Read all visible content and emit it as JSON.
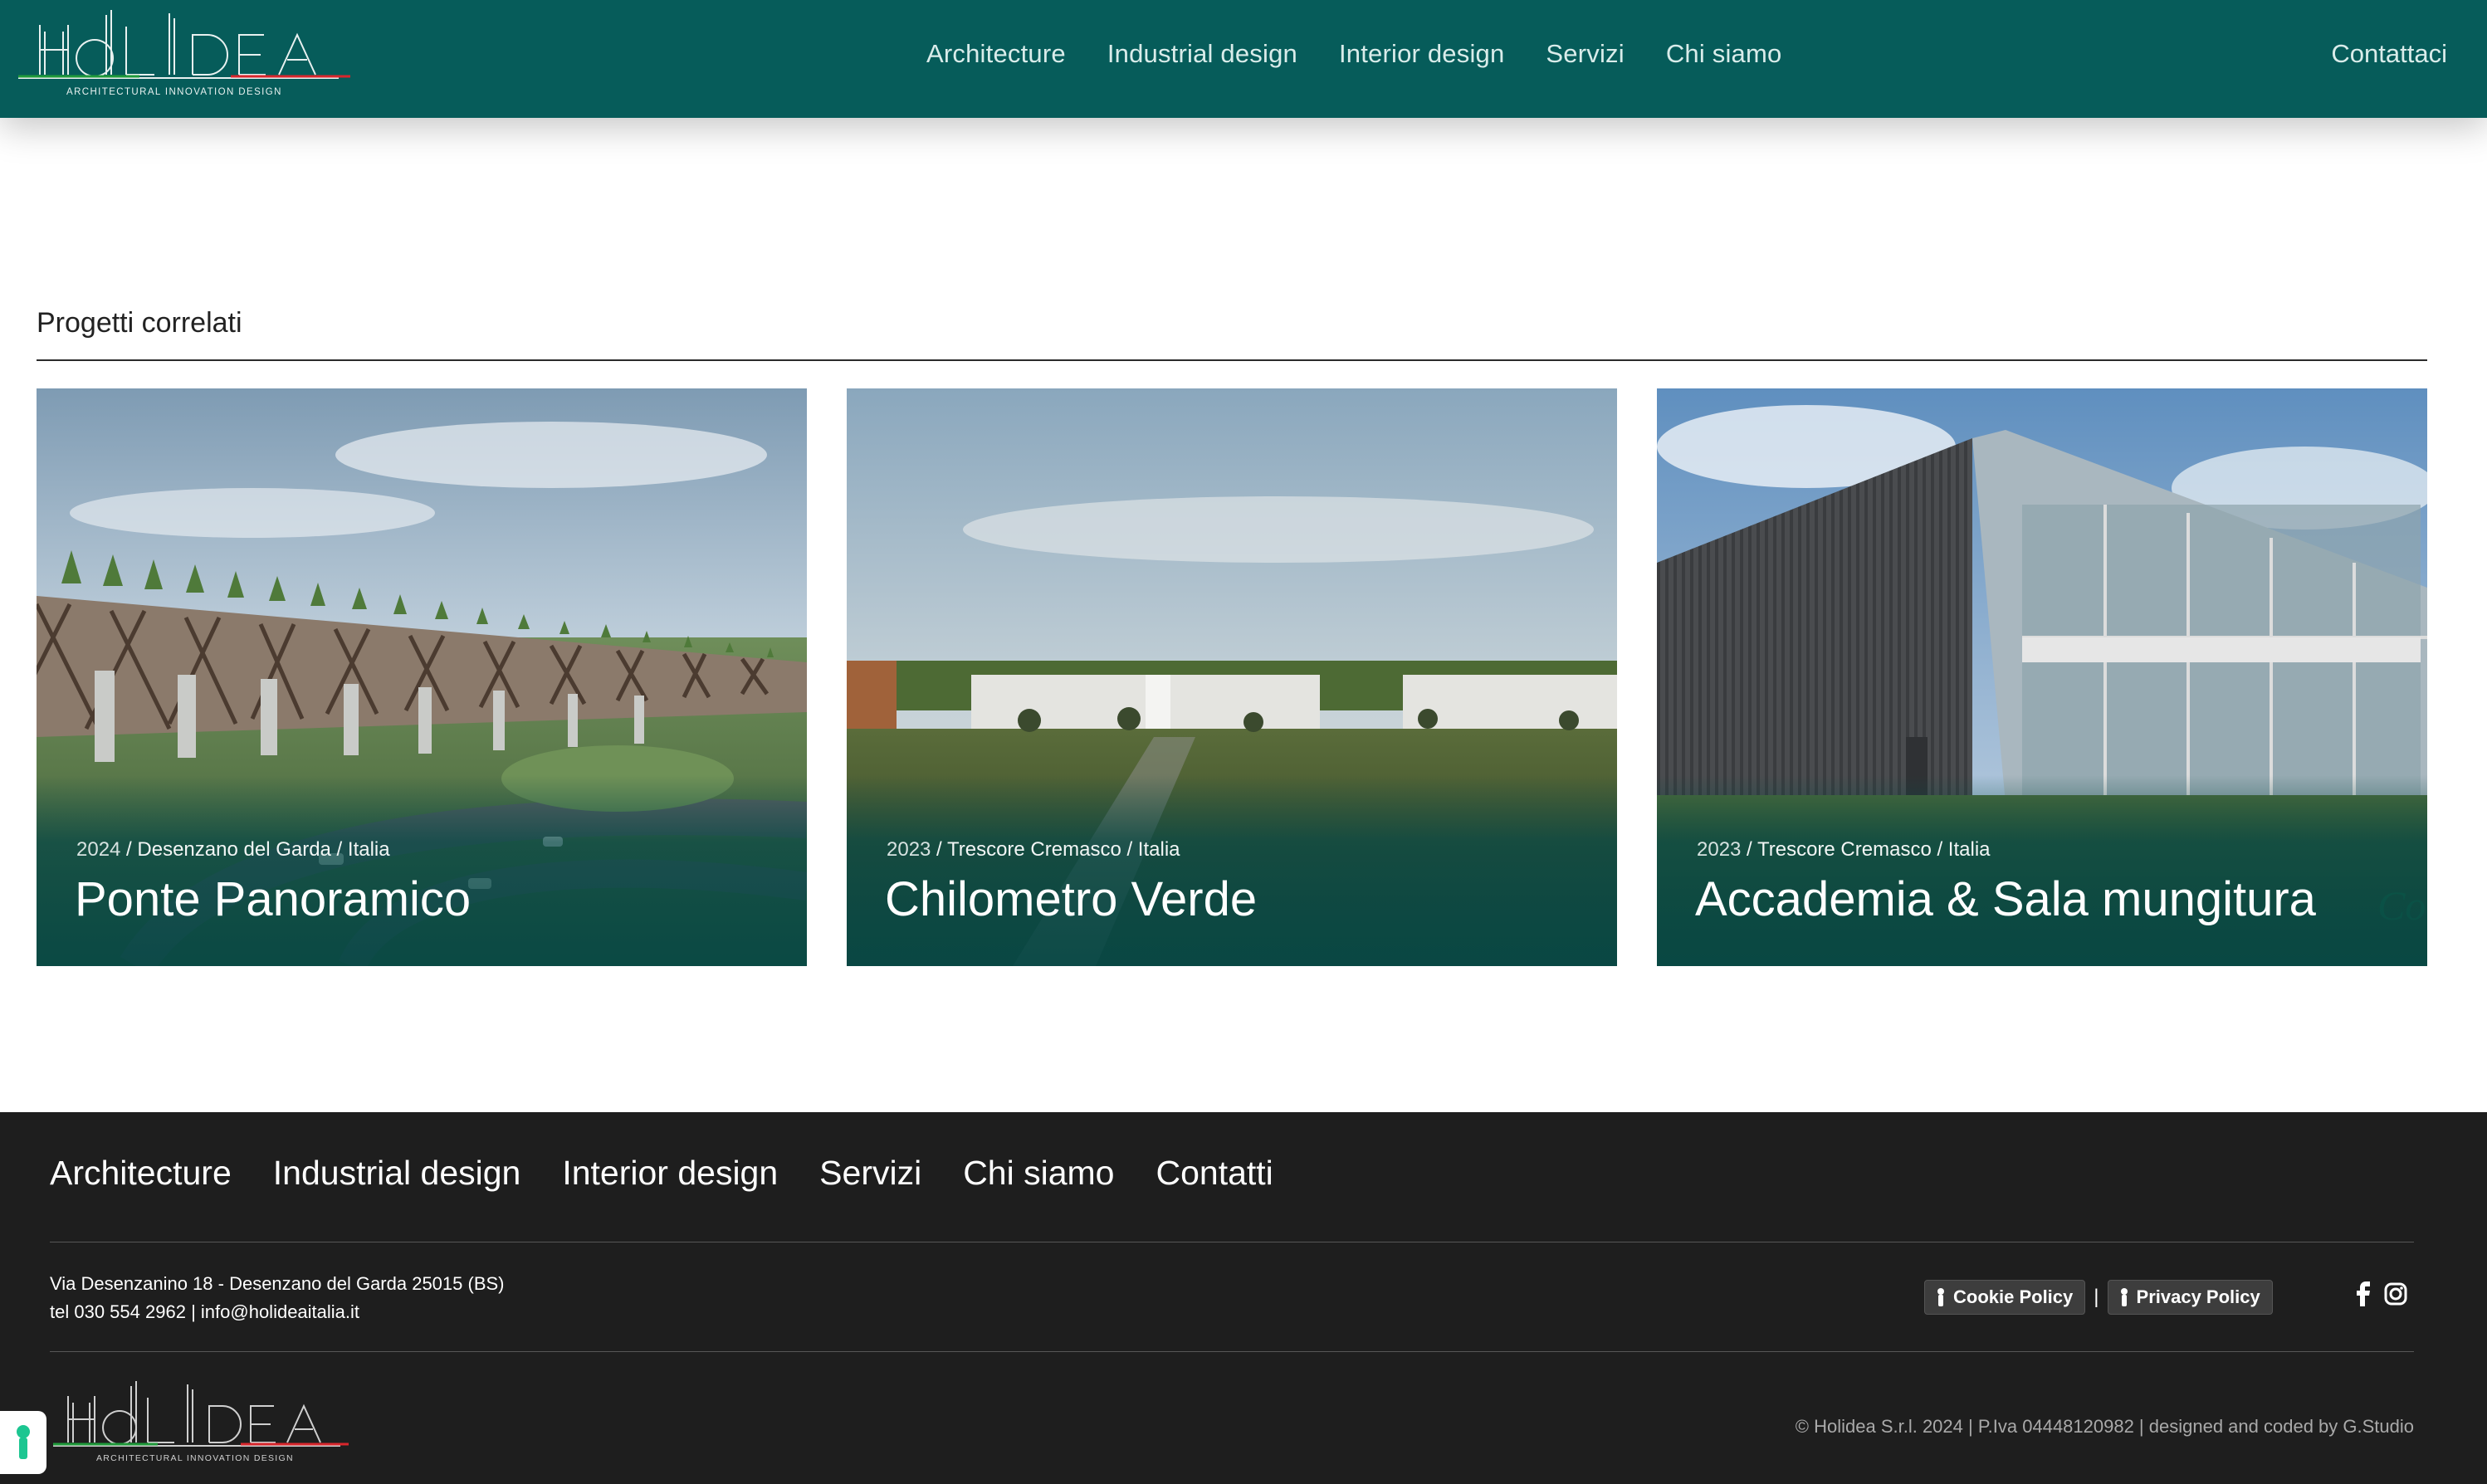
{
  "header": {
    "logo_text": "HOLIDEA",
    "logo_tagline": "ARCHITECTURAL INNOVATION DESIGN",
    "nav": [
      {
        "label": "Architecture"
      },
      {
        "label": "Industrial design"
      },
      {
        "label": "Interior design"
      },
      {
        "label": "Servizi"
      },
      {
        "label": "Chi siamo"
      }
    ],
    "contact_label": "Contattaci"
  },
  "related": {
    "heading": "Progetti correlati",
    "projects": [
      {
        "year": "2024",
        "location": "Desenzano del Garda / Italia",
        "title": "Ponte Panoramico"
      },
      {
        "year": "2023",
        "location": "Trescore Cremasco / Italia",
        "title": "Chilometro Verde"
      },
      {
        "year": "2023",
        "location": "Trescore Cremasco / Italia",
        "title": "Accademia & Sala mungitura"
      }
    ]
  },
  "footer": {
    "nav": [
      {
        "label": "Architecture"
      },
      {
        "label": "Industrial design"
      },
      {
        "label": "Interior design"
      },
      {
        "label": "Servizi"
      },
      {
        "label": "Chi siamo"
      },
      {
        "label": "Contatti"
      }
    ],
    "address_line": "Via Desenzanino 18 - Desenzano del Garda 25015 (BS)",
    "phone": "tel 030 554 2962",
    "separator": "|",
    "email": "info@holideaitalia.it",
    "cookie_policy": "Cookie Policy",
    "privacy_policy": "Privacy Policy",
    "social": [
      "facebook-icon",
      "instagram-icon"
    ],
    "copyright": "© Holidea S.r.l. 2024 | P.Iva 04448120982 | designed and coded by G.Studio"
  },
  "colors": {
    "brand_teal": "#065c5a",
    "footer_bg": "#1e1e1e",
    "logo_green": "#1f9a3a",
    "logo_red": "#d8262c"
  }
}
